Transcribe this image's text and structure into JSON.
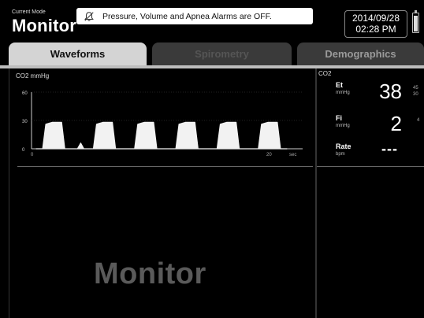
{
  "header": {
    "mode_caption": "Current Mode",
    "mode_title": "Monitor",
    "alarm_icon": "bell-icon",
    "alarm_text": "Pressure, Volume and Apnea Alarms are OFF.",
    "date": "2014/09/28",
    "time": "02:28 PM",
    "battery_icon": "battery-icon",
    "battery_level": 0.9
  },
  "tabs": [
    {
      "label": "Waveforms",
      "active": true
    },
    {
      "label": "Spirometry",
      "active": false
    },
    {
      "label": "Demographics",
      "active": false
    }
  ],
  "waveform": {
    "label": "CO2  mmHg",
    "y_ticks": [
      "60",
      "30",
      "0"
    ],
    "x_ticks": [
      "0",
      "20",
      "sec"
    ]
  },
  "chart_data": {
    "type": "line",
    "xlabel": "sec",
    "ylabel": "CO2 mmHg",
    "ylim": [
      0,
      60
    ],
    "x_ticks": [
      0,
      20
    ],
    "series": [
      {
        "values": [
          0,
          0,
          0,
          26,
          27,
          28,
          28,
          28,
          28,
          0,
          0,
          0,
          0,
          0,
          6,
          0,
          0,
          0,
          0,
          26,
          27,
          28,
          28,
          28,
          28,
          0,
          0,
          0,
          0,
          0,
          0,
          0,
          26,
          27,
          28,
          28,
          28,
          28,
          0,
          0,
          0,
          0,
          0,
          0,
          0,
          26,
          27,
          28,
          28,
          28,
          28,
          0,
          0,
          0,
          0,
          0,
          0,
          0,
          26,
          27,
          28,
          28,
          28,
          28,
          0,
          0,
          0,
          0,
          0,
          0,
          0,
          26,
          27,
          28,
          28,
          28,
          28,
          0,
          0,
          0
        ]
      }
    ]
  },
  "side": {
    "title": "CO2",
    "params": [
      {
        "label": "Et",
        "unit": "mmHg",
        "value": "38",
        "upper": "45",
        "lower": "30"
      },
      {
        "label": "Fi",
        "unit": "mmHg",
        "value": "2",
        "upper": "4",
        "lower": ""
      },
      {
        "label": "Rate",
        "unit": "bpm",
        "value": "---",
        "upper": "",
        "lower": ""
      }
    ]
  },
  "main": {
    "mode_watermark": "Monitor"
  }
}
